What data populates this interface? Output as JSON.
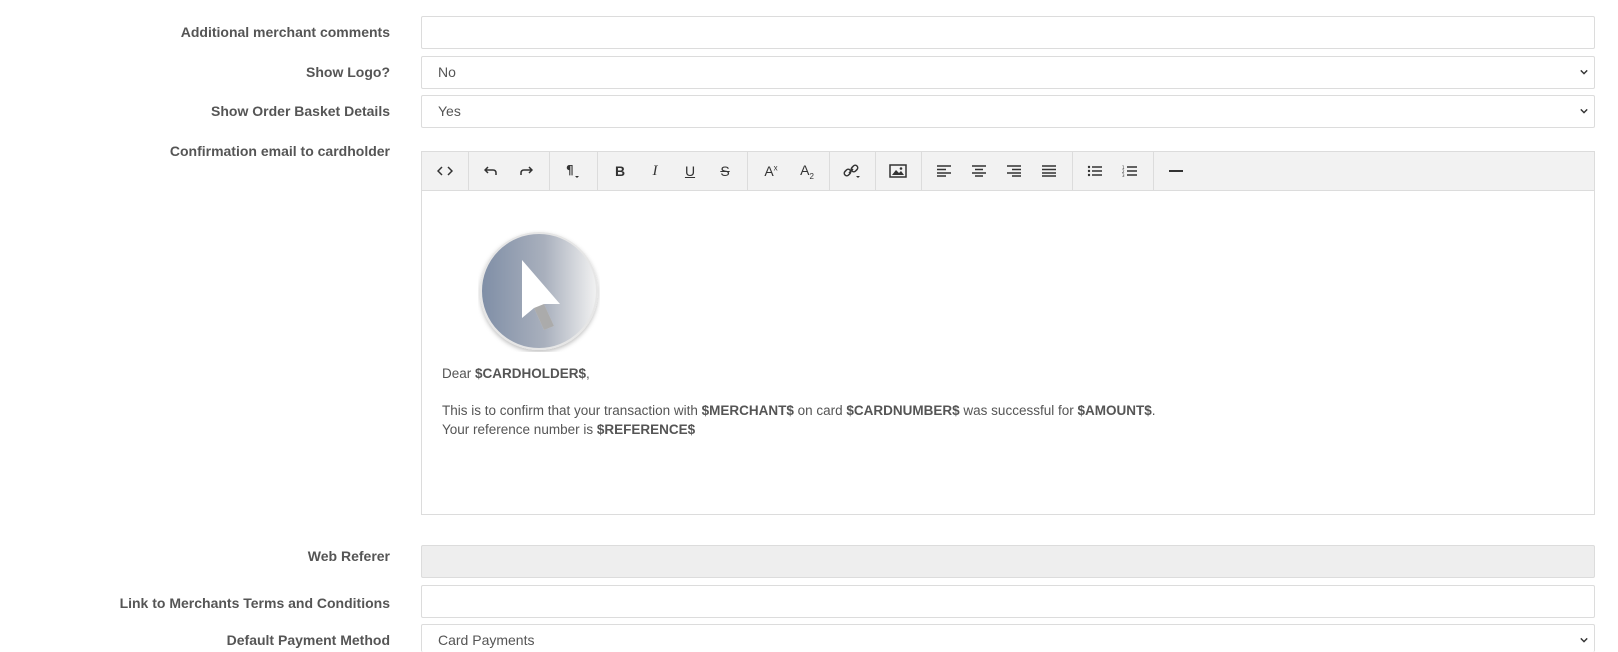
{
  "form": {
    "additional_comments": {
      "label": "Additional merchant comments",
      "value": ""
    },
    "show_logo": {
      "label": "Show Logo?",
      "value": "No"
    },
    "show_basket": {
      "label": "Show Order Basket Details",
      "value": "Yes"
    },
    "confirmation_email": {
      "label": "Confirmation email to cardholder"
    },
    "web_referer": {
      "label": "Web Referer",
      "value": ""
    },
    "terms_link": {
      "label": "Link to Merchants Terms and Conditions",
      "value": ""
    },
    "default_payment": {
      "label": "Default Payment Method",
      "value": "Card Payments"
    }
  },
  "editor": {
    "toolbar": [
      {
        "name": "code-view-icon",
        "glyph": "<>"
      },
      {
        "name": "undo-icon",
        "glyph": "↶"
      },
      {
        "name": "redo-icon",
        "glyph": "↷"
      },
      {
        "name": "paragraph-format-icon",
        "glyph": "¶"
      },
      {
        "name": "bold-icon",
        "glyph": "B"
      },
      {
        "name": "italic-icon",
        "glyph": "I"
      },
      {
        "name": "underline-icon",
        "glyph": "U"
      },
      {
        "name": "strikethrough-icon",
        "glyph": "S"
      },
      {
        "name": "superscript-icon",
        "glyph": "A²"
      },
      {
        "name": "subscript-icon",
        "glyph": "A₂"
      },
      {
        "name": "link-icon",
        "glyph": "🔗"
      },
      {
        "name": "image-icon",
        "glyph": "▣"
      },
      {
        "name": "align-left-icon",
        "glyph": "≡"
      },
      {
        "name": "align-center-icon",
        "glyph": "≡"
      },
      {
        "name": "align-right-icon",
        "glyph": "≡"
      },
      {
        "name": "align-justify-icon",
        "glyph": "≡"
      },
      {
        "name": "bullet-list-icon",
        "glyph": "•"
      },
      {
        "name": "numbered-list-icon",
        "glyph": "1."
      },
      {
        "name": "horizontal-rule-icon",
        "glyph": "—"
      }
    ],
    "body": {
      "greeting_prefix": "Dear ",
      "cardholder_token": "$CARDHOLDER$",
      "greeting_suffix": ",",
      "line1_a": "This is to confirm that your transaction with ",
      "merchant_token": "$MERCHANT$",
      "line1_b": " on card ",
      "cardnumber_token": "$CARDNUMBER$",
      "line1_c": " was successful for ",
      "amount_token": "$AMOUNT$",
      "line1_d": ".",
      "line2_a": "Your reference number is ",
      "reference_token": "$REFERENCE$"
    }
  },
  "colors": {
    "label_text": "#555555",
    "border": "#dcdcdc",
    "toolbar_bg": "#f2f2f2",
    "disabled_bg": "#eeeeee"
  }
}
